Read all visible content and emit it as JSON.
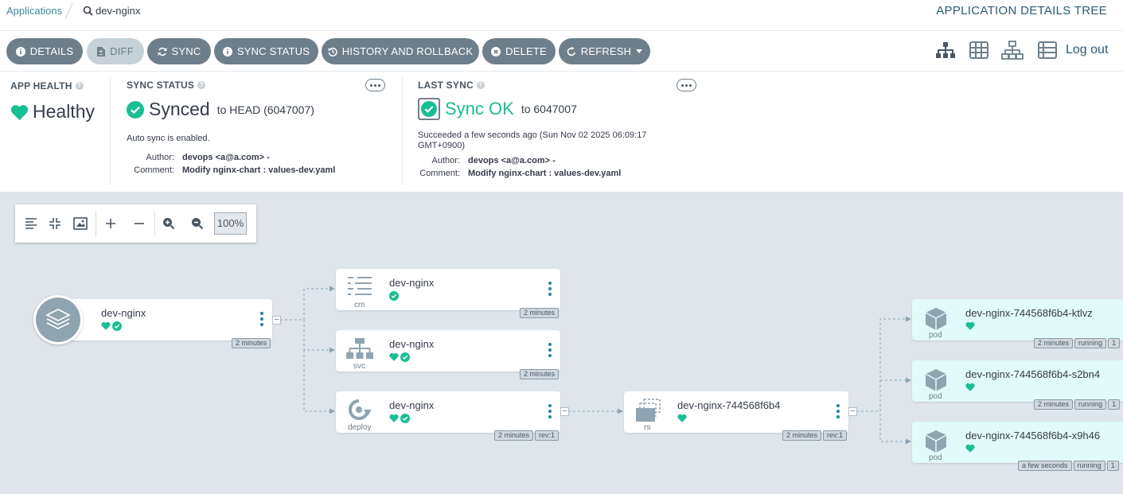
{
  "breadcrumb": {
    "root": "Applications",
    "current": "dev-nginx"
  },
  "page_title": "APPLICATION DETAILS TREE",
  "toolbar": {
    "details": "DETAILS",
    "diff": "DIFF",
    "sync": "SYNC",
    "sync_status": "SYNC STATUS",
    "history": "HISTORY AND ROLLBACK",
    "delete": "DELETE",
    "refresh": "REFRESH",
    "logout": "Log out"
  },
  "app_health": {
    "label": "APP HEALTH",
    "value": "Healthy"
  },
  "sync_status": {
    "label": "SYNC STATUS",
    "value": "Synced",
    "target": "to HEAD (6047007)",
    "auto_sync": "Auto sync is enabled.",
    "author_label": "Author:",
    "author": "devops <a@a.com> -",
    "comment_label": "Comment:",
    "comment": "Modify nginx-chart : values-dev.yaml"
  },
  "last_sync": {
    "label": "LAST SYNC",
    "value": "Sync OK",
    "target": "to 6047007",
    "detail": "Succeeded a few seconds ago (Sun Nov 02 2025 06:09:17 GMT+0900)",
    "author_label": "Author:",
    "author": "devops <a@a.com> -",
    "comment_label": "Comment:",
    "comment": "Modify nginx-chart : values-dev.yaml"
  },
  "zoom": {
    "value": "100%"
  },
  "nodes": {
    "app": {
      "name": "dev-nginx",
      "tags": [
        "2 minutes"
      ]
    },
    "cm": {
      "name": "dev-nginx",
      "kind": "cm",
      "tags": [
        "2 minutes"
      ]
    },
    "svc": {
      "name": "dev-nginx",
      "kind": "svc",
      "tags": [
        "2 minutes"
      ]
    },
    "deploy": {
      "name": "dev-nginx",
      "kind": "deploy",
      "tags": [
        "2 minutes",
        "rev:1"
      ]
    },
    "rs": {
      "name": "dev-nginx-744568f6b4",
      "kind": "rs",
      "tags": [
        "2 minutes",
        "rev:1"
      ]
    },
    "pod1": {
      "name": "dev-nginx-744568f6b4-ktlvz",
      "kind": "pod",
      "tags": [
        "2 minutes",
        "running",
        "1"
      ]
    },
    "pod2": {
      "name": "dev-nginx-744568f6b4-s2bn4",
      "kind": "pod",
      "tags": [
        "2 minutes",
        "running",
        "1"
      ]
    },
    "pod3": {
      "name": "dev-nginx-744568f6b4-x9h46",
      "kind": "pod",
      "tags": [
        "a few seconds",
        "running",
        "1"
      ]
    }
  },
  "colors": {
    "healthy": "#18be94",
    "link": "#3a8ba3",
    "button": "#6d7f8b",
    "pod_bg": "#e1fafa"
  }
}
